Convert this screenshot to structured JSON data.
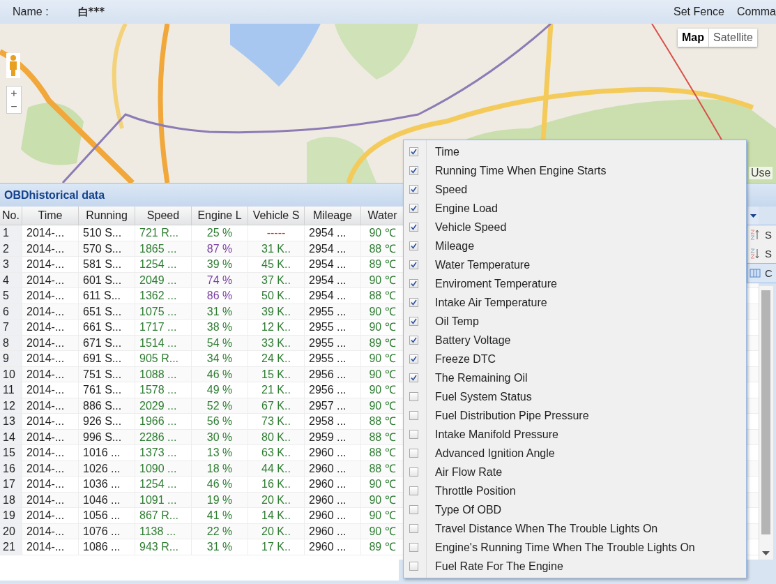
{
  "header": {
    "name_label": "Name :",
    "name_value": "白***",
    "actions": [
      "Set Fence",
      "Comma"
    ]
  },
  "map": {
    "kind": "picture",
    "zoom_in": "+",
    "zoom_out": "−",
    "terms": "Use",
    "map_types": [
      {
        "label": "Map",
        "selected": true
      },
      {
        "label": "Satellite",
        "selected": false
      }
    ]
  },
  "panel": {
    "title": "OBDhistorical data"
  },
  "table": {
    "columns": [
      "No.",
      "Time",
      "Running",
      "Speed",
      "Engine L",
      "Vehicle S",
      "Mileage",
      "Water"
    ],
    "rows": [
      {
        "no": "1",
        "time": "2014-...",
        "running": "510 S...",
        "speed": "721 R...",
        "engine_load": "25 %",
        "engine_load_high": false,
        "vehicle_speed": "-----",
        "vehicle_speed_missing": true,
        "mileage": "2954 ...",
        "water": "90 ℃"
      },
      {
        "no": "2",
        "time": "2014-...",
        "running": "570 S...",
        "speed": "1865 ...",
        "engine_load": "87 %",
        "engine_load_high": true,
        "vehicle_speed": "31 K..",
        "vehicle_speed_missing": false,
        "mileage": "2954 ...",
        "water": "88 ℃"
      },
      {
        "no": "3",
        "time": "2014-...",
        "running": "581 S...",
        "speed": "1254 ...",
        "engine_load": "39 %",
        "engine_load_high": false,
        "vehicle_speed": "45 K..",
        "vehicle_speed_missing": false,
        "mileage": "2954 ...",
        "water": "89 ℃"
      },
      {
        "no": "4",
        "time": "2014-...",
        "running": "601 S...",
        "speed": "2049 ...",
        "engine_load": "74 %",
        "engine_load_high": true,
        "vehicle_speed": "37 K..",
        "vehicle_speed_missing": false,
        "mileage": "2954 ...",
        "water": "90 ℃"
      },
      {
        "no": "5",
        "time": "2014-...",
        "running": "611 S...",
        "speed": "1362 ...",
        "engine_load": "86 %",
        "engine_load_high": true,
        "vehicle_speed": "50 K..",
        "vehicle_speed_missing": false,
        "mileage": "2954 ...",
        "water": "88 ℃"
      },
      {
        "no": "6",
        "time": "2014-...",
        "running": "651 S...",
        "speed": "1075 ...",
        "engine_load": "31 %",
        "engine_load_high": false,
        "vehicle_speed": "39 K..",
        "vehicle_speed_missing": false,
        "mileage": "2955 ...",
        "water": "90 ℃"
      },
      {
        "no": "7",
        "time": "2014-...",
        "running": "661 S...",
        "speed": "1717 ...",
        "engine_load": "38 %",
        "engine_load_high": false,
        "vehicle_speed": "12 K..",
        "vehicle_speed_missing": false,
        "mileage": "2955 ...",
        "water": "90 ℃"
      },
      {
        "no": "8",
        "time": "2014-...",
        "running": "671 S...",
        "speed": "1514 ...",
        "engine_load": "54 %",
        "engine_load_high": false,
        "vehicle_speed": "33 K..",
        "vehicle_speed_missing": false,
        "mileage": "2955 ...",
        "water": "89 ℃"
      },
      {
        "no": "9",
        "time": "2014-...",
        "running": "691 S...",
        "speed": "905 R...",
        "engine_load": "34 %",
        "engine_load_high": false,
        "vehicle_speed": "24 K..",
        "vehicle_speed_missing": false,
        "mileage": "2955 ...",
        "water": "90 ℃"
      },
      {
        "no": "10",
        "time": "2014-...",
        "running": "751 S...",
        "speed": "1088 ...",
        "engine_load": "46 %",
        "engine_load_high": false,
        "vehicle_speed": "15 K..",
        "vehicle_speed_missing": false,
        "mileage": "2956 ...",
        "water": "90 ℃"
      },
      {
        "no": "11",
        "time": "2014-...",
        "running": "761 S...",
        "speed": "1578 ...",
        "engine_load": "49 %",
        "engine_load_high": false,
        "vehicle_speed": "21 K..",
        "vehicle_speed_missing": false,
        "mileage": "2956 ...",
        "water": "90 ℃"
      },
      {
        "no": "12",
        "time": "2014-...",
        "running": "886 S...",
        "speed": "2029 ...",
        "engine_load": "52 %",
        "engine_load_high": false,
        "vehicle_speed": "67 K..",
        "vehicle_speed_missing": false,
        "mileage": "2957 ...",
        "water": "90 ℃"
      },
      {
        "no": "13",
        "time": "2014-...",
        "running": "926 S...",
        "speed": "1966 ...",
        "engine_load": "56 %",
        "engine_load_high": false,
        "vehicle_speed": "73 K..",
        "vehicle_speed_missing": false,
        "mileage": "2958 ...",
        "water": "88 ℃"
      },
      {
        "no": "14",
        "time": "2014-...",
        "running": "996 S...",
        "speed": "2286 ...",
        "engine_load": "30 %",
        "engine_load_high": false,
        "vehicle_speed": "80 K..",
        "vehicle_speed_missing": false,
        "mileage": "2959 ...",
        "water": "88 ℃"
      },
      {
        "no": "15",
        "time": "2014-...",
        "running": "1016 ...",
        "speed": "1373 ...",
        "engine_load": "13 %",
        "engine_load_high": false,
        "vehicle_speed": "63 K..",
        "vehicle_speed_missing": false,
        "mileage": "2960 ...",
        "water": "88 ℃"
      },
      {
        "no": "16",
        "time": "2014-...",
        "running": "1026 ...",
        "speed": "1090 ...",
        "engine_load": "18 %",
        "engine_load_high": false,
        "vehicle_speed": "44 K..",
        "vehicle_speed_missing": false,
        "mileage": "2960 ...",
        "water": "88 ℃"
      },
      {
        "no": "17",
        "time": "2014-...",
        "running": "1036 ...",
        "speed": "1254 ...",
        "engine_load": "46 %",
        "engine_load_high": false,
        "vehicle_speed": "16 K..",
        "vehicle_speed_missing": false,
        "mileage": "2960 ...",
        "water": "90 ℃"
      },
      {
        "no": "18",
        "time": "2014-...",
        "running": "1046 ...",
        "speed": "1091 ...",
        "engine_load": "19 %",
        "engine_load_high": false,
        "vehicle_speed": "20 K..",
        "vehicle_speed_missing": false,
        "mileage": "2960 ...",
        "water": "90 ℃"
      },
      {
        "no": "19",
        "time": "2014-...",
        "running": "1056 ...",
        "speed": "867 R...",
        "engine_load": "41 %",
        "engine_load_high": false,
        "vehicle_speed": "14 K..",
        "vehicle_speed_missing": false,
        "mileage": "2960 ...",
        "water": "90 ℃"
      },
      {
        "no": "20",
        "time": "2014-...",
        "running": "1076 ...",
        "speed": "1138 ...",
        "engine_load": "22 %",
        "engine_load_high": false,
        "vehicle_speed": "20 K..",
        "vehicle_speed_missing": false,
        "mileage": "2960 ...",
        "water": "90 ℃"
      },
      {
        "no": "21",
        "time": "2014-...",
        "running": "1086 ...",
        "speed": "943 R...",
        "engine_load": "31 %",
        "engine_load_high": false,
        "vehicle_speed": "17 K..",
        "vehicle_speed_missing": false,
        "mileage": "2960 ...",
        "water": "89 ℃"
      }
    ]
  },
  "sort_menu": {
    "items": [
      {
        "kind": "sort-asc",
        "label": "S",
        "selected": false
      },
      {
        "kind": "sort-desc",
        "label": "S",
        "selected": false
      },
      {
        "kind": "columns",
        "label": "C",
        "selected": true
      }
    ]
  },
  "column_menu": {
    "items": [
      {
        "label": "Time",
        "checked": true
      },
      {
        "label": "Running Time When Engine Starts",
        "checked": true
      },
      {
        "label": "Speed",
        "checked": true
      },
      {
        "label": "Engine Load",
        "checked": true
      },
      {
        "label": "Vehicle Speed",
        "checked": true
      },
      {
        "label": "Mileage",
        "checked": true
      },
      {
        "label": "Water Temperature",
        "checked": true
      },
      {
        "label": "Enviroment Temperature",
        "checked": true
      },
      {
        "label": "Intake Air Temperature",
        "checked": true
      },
      {
        "label": "Oil Temp",
        "checked": true
      },
      {
        "label": "Battery Voltage",
        "checked": true
      },
      {
        "label": "Freeze DTC",
        "checked": true
      },
      {
        "label": "The Remaining Oil",
        "checked": true
      },
      {
        "label": "Fuel System Status",
        "checked": false
      },
      {
        "label": "Fuel Distribution Pipe Pressure",
        "checked": false
      },
      {
        "label": "Intake Manifold Pressure",
        "checked": false
      },
      {
        "label": "Advanced Ignition Angle",
        "checked": false
      },
      {
        "label": "Air Flow Rate",
        "checked": false
      },
      {
        "label": "Throttle Position",
        "checked": false
      },
      {
        "label": "Type Of OBD",
        "checked": false
      },
      {
        "label": "Travel Distance When The Trouble Lights On",
        "checked": false
      },
      {
        "label": "Engine's Running Time When The Trouble Lights On",
        "checked": false
      },
      {
        "label": "Fuel Rate For The Engine",
        "checked": false
      }
    ]
  }
}
